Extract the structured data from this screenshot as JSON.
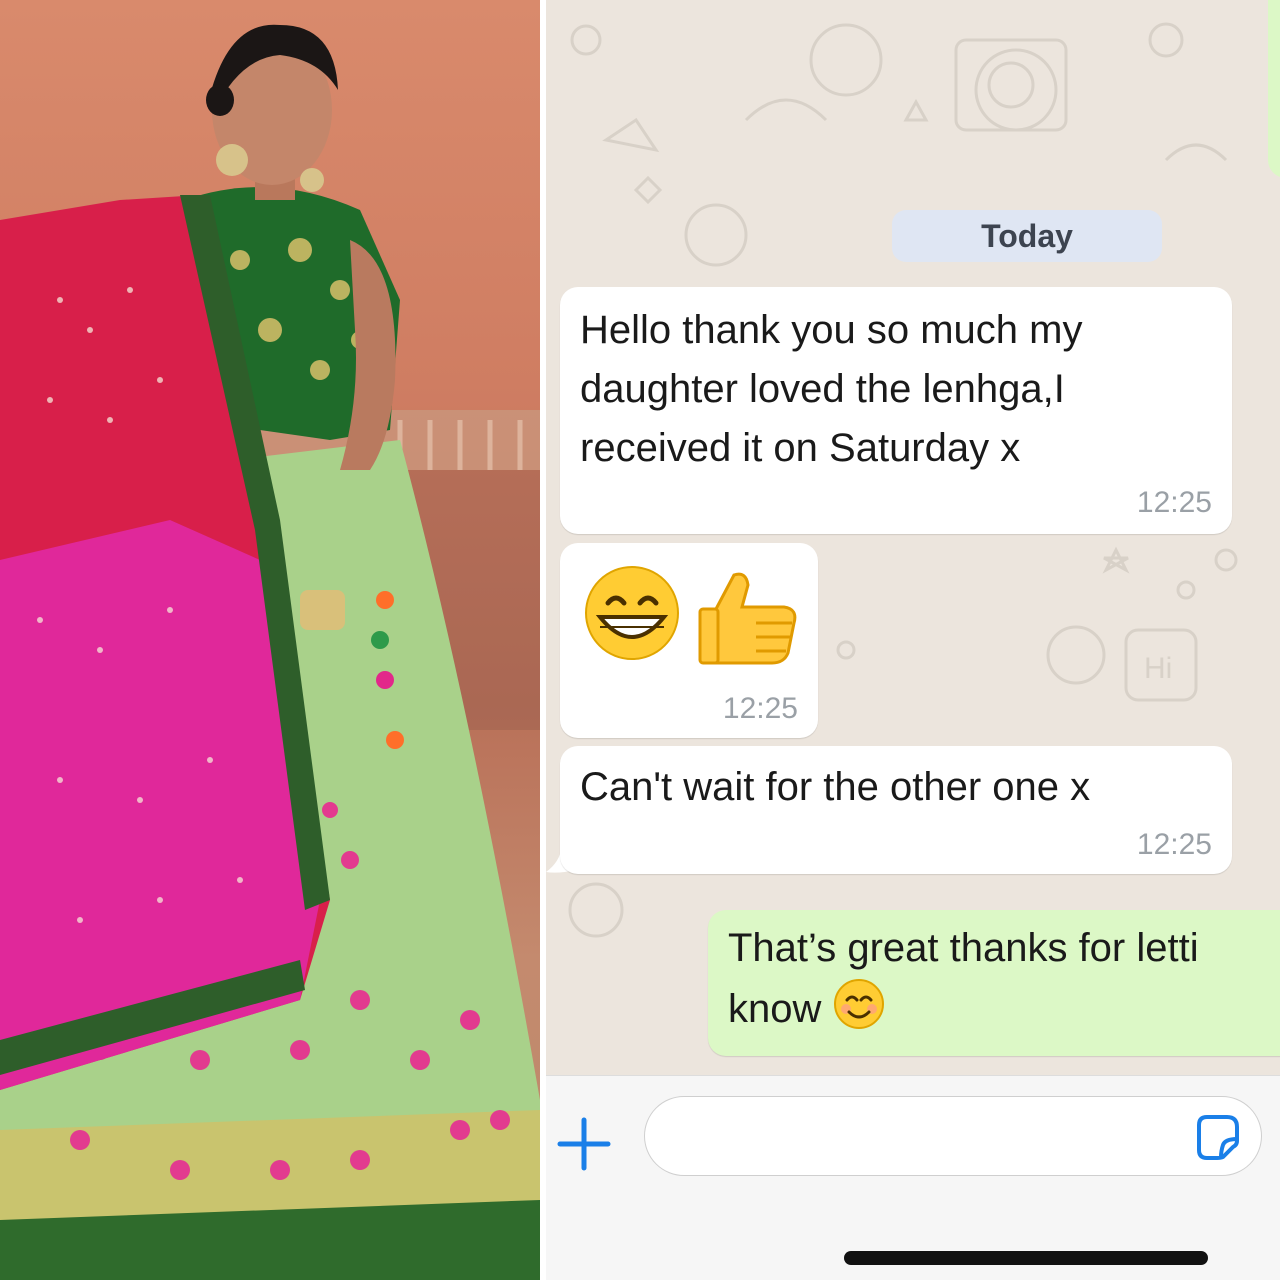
{
  "photo": {
    "alt_description_icon": "lehenga-product-photo"
  },
  "chat": {
    "date_separator": "Today",
    "messages": [
      {
        "direction": "incoming",
        "lines": [
          "Hello thank you so much my",
          "daughter loved the lenhga,I",
          "received it on Saturday x"
        ],
        "time": "12:25"
      },
      {
        "direction": "incoming",
        "emojis": [
          "grinning-face-icon",
          "thumbs-up-icon"
        ],
        "time": "12:25"
      },
      {
        "direction": "incoming",
        "lines": [
          "Can't wait for the other one x"
        ],
        "time": "12:25"
      },
      {
        "direction": "outgoing",
        "lines": [
          "That’s great thanks for letti",
          "know"
        ],
        "emoji": "smiling-face-icon"
      }
    ]
  },
  "input_bar": {
    "placeholder": "",
    "plus_icon": "plus-icon",
    "sticker_icon": "sticker-icon"
  },
  "colors": {
    "incoming_bubble": "#ffffff",
    "outgoing_bubble": "#dcf8c6",
    "chat_background": "#ece5dd",
    "accent_blue": "#1a7fe8"
  }
}
